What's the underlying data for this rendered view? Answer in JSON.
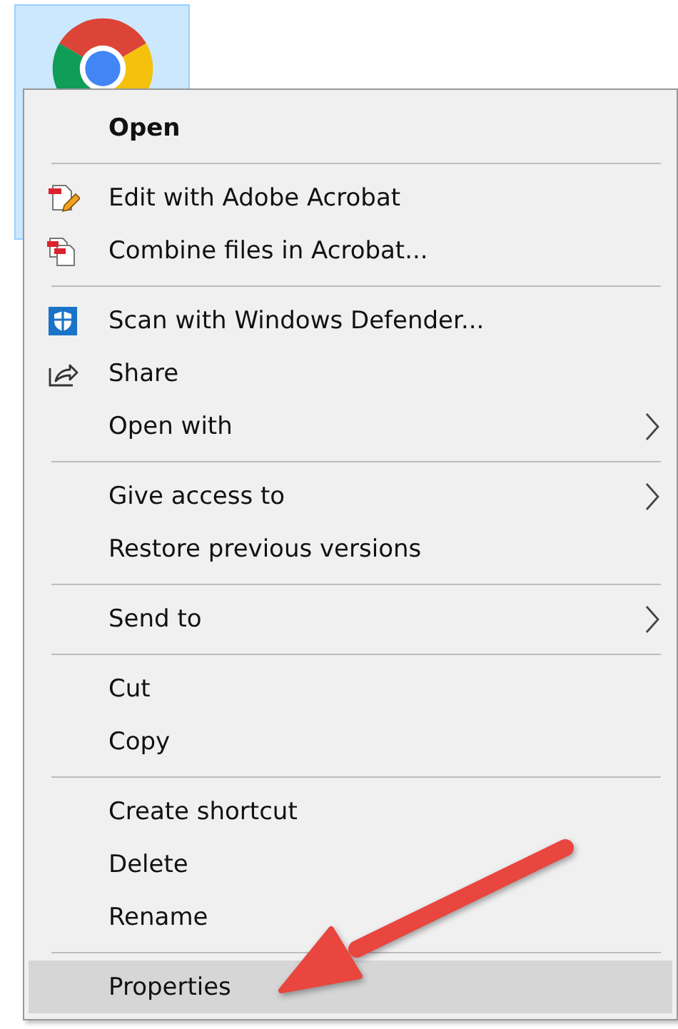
{
  "desktop_icon": {
    "selected": true
  },
  "context_menu": {
    "sections": [
      {
        "items": [
          {
            "label": "Open",
            "kind": "plain",
            "default": true,
            "submenu": false,
            "selected": false
          }
        ]
      },
      {
        "items": [
          {
            "label": "Edit with Adobe Acrobat",
            "kind": "edit",
            "default": false,
            "submenu": false,
            "selected": false
          },
          {
            "label": "Combine files in Acrobat...",
            "kind": "combine",
            "default": false,
            "submenu": false,
            "selected": false
          }
        ]
      },
      {
        "items": [
          {
            "label": "Scan with Windows Defender...",
            "kind": "scan",
            "default": false,
            "submenu": false,
            "selected": false
          },
          {
            "label": "Share",
            "kind": "share",
            "default": false,
            "submenu": false,
            "selected": false
          },
          {
            "label": "Open with",
            "kind": "plain",
            "default": false,
            "submenu": true,
            "selected": false
          }
        ]
      },
      {
        "items": [
          {
            "label": "Give access to",
            "kind": "plain",
            "default": false,
            "submenu": true,
            "selected": false
          },
          {
            "label": "Restore previous versions",
            "kind": "plain",
            "default": false,
            "submenu": false,
            "selected": false
          }
        ]
      },
      {
        "items": [
          {
            "label": "Send to",
            "kind": "plain",
            "default": false,
            "submenu": true,
            "selected": false
          }
        ]
      },
      {
        "items": [
          {
            "label": "Cut",
            "kind": "plain",
            "default": false,
            "submenu": false,
            "selected": false
          },
          {
            "label": "Copy",
            "kind": "plain",
            "default": false,
            "submenu": false,
            "selected": false
          }
        ]
      },
      {
        "items": [
          {
            "label": "Create shortcut",
            "kind": "plain",
            "default": false,
            "submenu": false,
            "selected": false
          },
          {
            "label": "Delete",
            "kind": "plain",
            "default": false,
            "submenu": false,
            "selected": false
          },
          {
            "label": "Rename",
            "kind": "plain",
            "default": false,
            "submenu": false,
            "selected": false
          }
        ]
      },
      {
        "items": [
          {
            "label": "Properties",
            "kind": "plain",
            "default": false,
            "submenu": false,
            "selected": true
          }
        ]
      }
    ]
  }
}
